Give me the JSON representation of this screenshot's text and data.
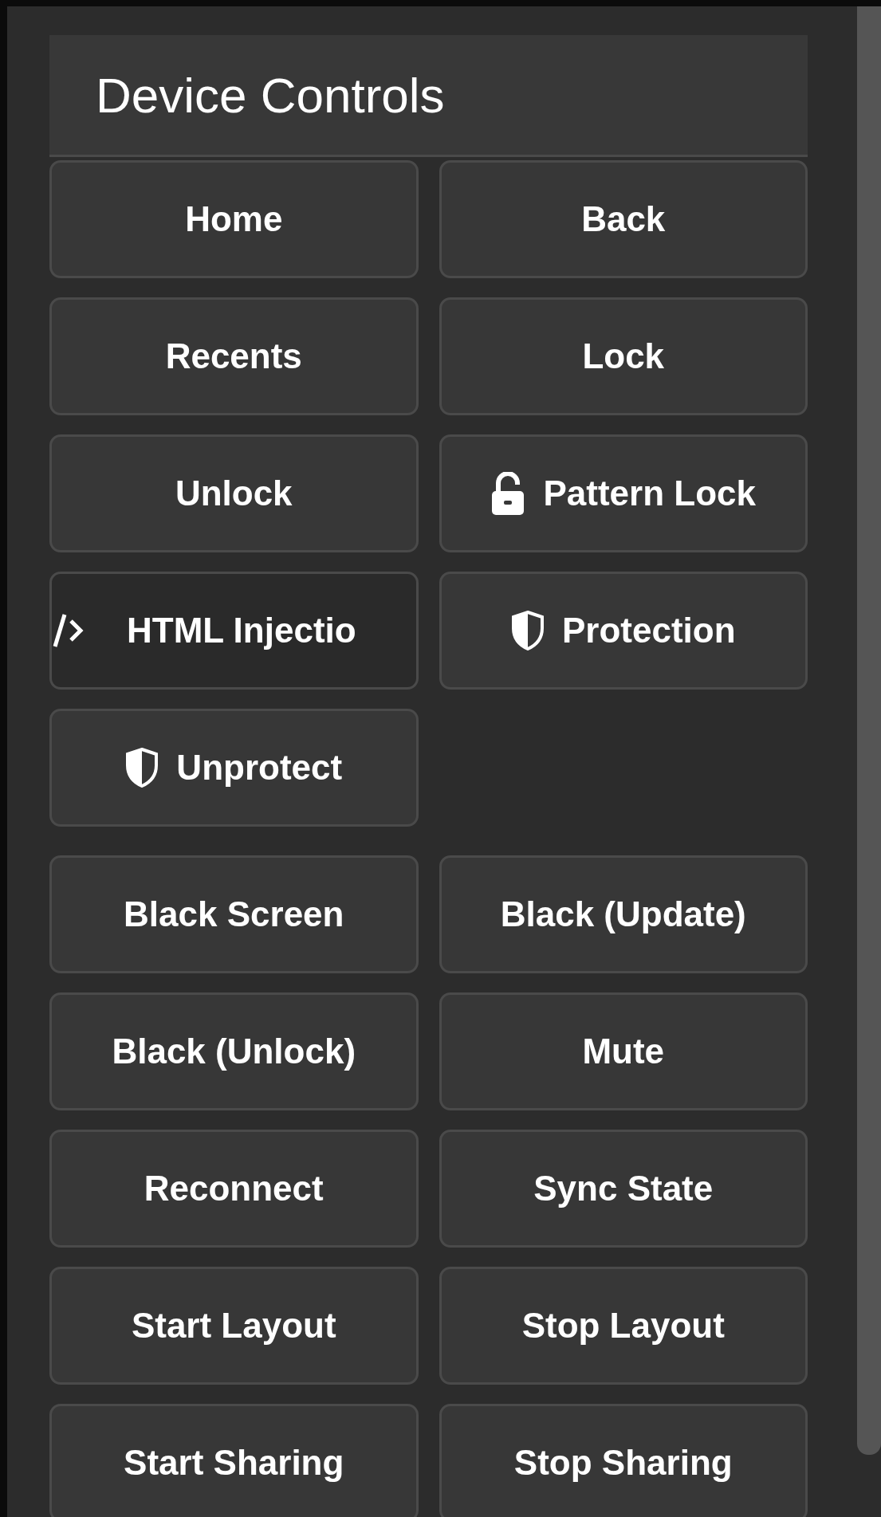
{
  "panel": {
    "title": "Device Controls"
  },
  "groups": [
    [
      {
        "label": "Home",
        "kind": "plain",
        "pressed": false
      },
      {
        "label": "Back",
        "kind": "plain",
        "pressed": false
      },
      {
        "label": "Recents",
        "kind": "plain",
        "pressed": false
      },
      {
        "label": "Lock",
        "kind": "plain",
        "pressed": false
      },
      {
        "label": "Unlock",
        "kind": "plain",
        "pressed": false
      },
      {
        "label": "Pattern Lock",
        "kind": "padlock",
        "pressed": false
      },
      {
        "label": "HTML Injectio",
        "kind": "code",
        "pressed": true
      },
      {
        "label": "Protection",
        "kind": "shield",
        "pressed": false
      },
      {
        "label": "Unprotect",
        "kind": "shield",
        "pressed": false
      }
    ],
    [
      {
        "label": "Black Screen",
        "kind": "plain",
        "pressed": false
      },
      {
        "label": "Black (Update)",
        "kind": "plain",
        "pressed": false
      },
      {
        "label": "Black (Unlock)",
        "kind": "plain",
        "pressed": false
      },
      {
        "label": "Mute",
        "kind": "plain",
        "pressed": false
      },
      {
        "label": "Reconnect",
        "kind": "plain",
        "pressed": false
      },
      {
        "label": "Sync State",
        "kind": "plain",
        "pressed": false
      },
      {
        "label": "Start Layout",
        "kind": "plain",
        "pressed": false
      },
      {
        "label": "Stop Layout",
        "kind": "plain",
        "pressed": false
      },
      {
        "label": "Start Sharing",
        "kind": "plain",
        "pressed": false
      },
      {
        "label": "Stop Sharing",
        "kind": "plain",
        "pressed": false
      }
    ]
  ]
}
